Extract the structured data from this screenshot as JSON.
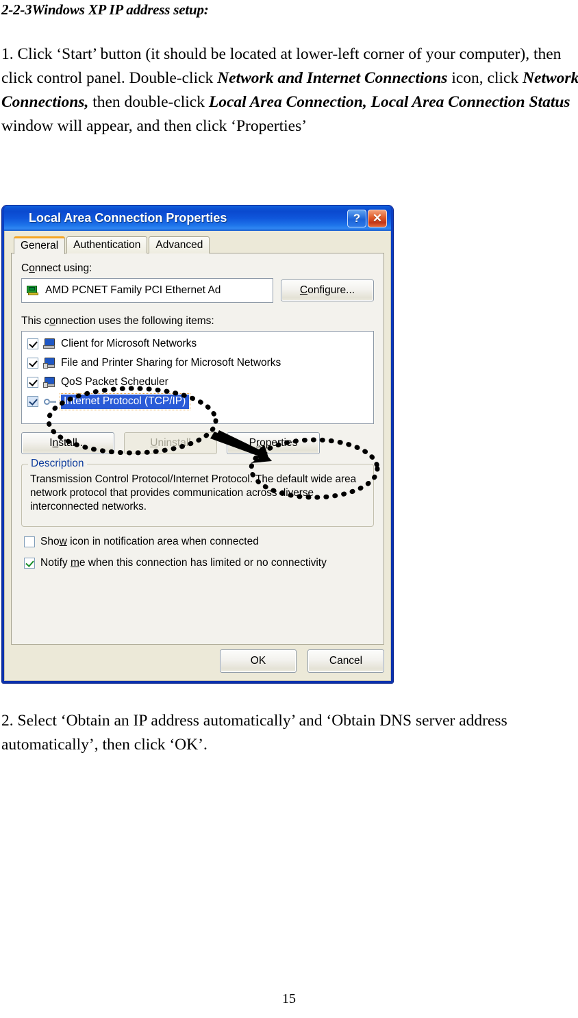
{
  "document": {
    "heading": "2-2-3Windows XP IP address setup:",
    "paragraph_1_parts": [
      {
        "text": "1. Click ‘Start’ button (it should be located at lower-left corner of your computer), then click control panel. Double-click ",
        "bold": false
      },
      {
        "text": "Network and Internet Connections",
        "bold": true
      },
      {
        "text": " icon, click ",
        "bold": false
      },
      {
        "text": "Network Connections,",
        "bold": true
      },
      {
        "text": " then double-click ",
        "bold": false
      },
      {
        "text": "Local Area Connection, Local Area Connection Status",
        "bold": true
      },
      {
        "text": " window will appear, and then click ‘Properties’",
        "bold": false
      }
    ],
    "paragraph_2": "2. Select ‘Obtain an IP address automatically’ and ‘Obtain DNS server address automatically’, then click ‘OK’.",
    "page_number": "15"
  },
  "dialog": {
    "title": "Local Area Connection Properties",
    "title_icon": "network-connection-icon",
    "help_button": "?",
    "close_button": "✕",
    "tabs": [
      {
        "label": "General",
        "active": true
      },
      {
        "label": "Authentication",
        "active": false
      },
      {
        "label": "Advanced",
        "active": false
      }
    ],
    "connect_using": {
      "label": "Connect using:",
      "adapter": "AMD PCNET Family PCI Ethernet Ad",
      "adapter_icon": "network-adapter-icon",
      "configure_button": "Configure..."
    },
    "items_section": {
      "label": "This connection uses the following items:",
      "items": [
        {
          "label": "Client for Microsoft Networks",
          "checked": true,
          "selected": false,
          "icon": "client-computer-icon"
        },
        {
          "label": "File and Printer Sharing for Microsoft Networks",
          "checked": true,
          "selected": false,
          "icon": "file-sharing-icon"
        },
        {
          "label": "QoS Packet Scheduler",
          "checked": true,
          "selected": false,
          "icon": "qos-scheduler-icon"
        },
        {
          "label": "Internet Protocol (TCP/IP)",
          "checked": true,
          "selected": true,
          "icon": "protocol-icon"
        }
      ]
    },
    "item_buttons": {
      "install": "Install...",
      "uninstall": "Uninstall",
      "properties": "Properties",
      "uninstall_disabled": true
    },
    "description": {
      "title": "Description",
      "text": "Transmission Control Protocol/Internet Protocol. The default wide area network protocol that provides communication across diverse interconnected networks."
    },
    "options": [
      {
        "label": "Show icon in notification area when connected",
        "checked": false
      },
      {
        "label": "Notify me when this connection has limited or no connectivity",
        "checked": true
      }
    ],
    "footer": {
      "ok": "OK",
      "cancel": "Cancel"
    },
    "colors": {
      "titlebar_blue": "#0a49cf",
      "body_beige": "#ece9d8",
      "panel_cream": "#f3f2ed",
      "selection_blue": "#2a5bd7",
      "active_tab_accent": "#f5a623",
      "groupbox_title": "#0b3a9c",
      "close_red": "#c2371a"
    }
  },
  "annotations": {
    "ellipse_protocol": "dotted-ellipse-around-internet-protocol",
    "ellipse_properties": "dotted-ellipse-around-properties-button",
    "arrow": "arrow-from-protocol-to-properties"
  }
}
